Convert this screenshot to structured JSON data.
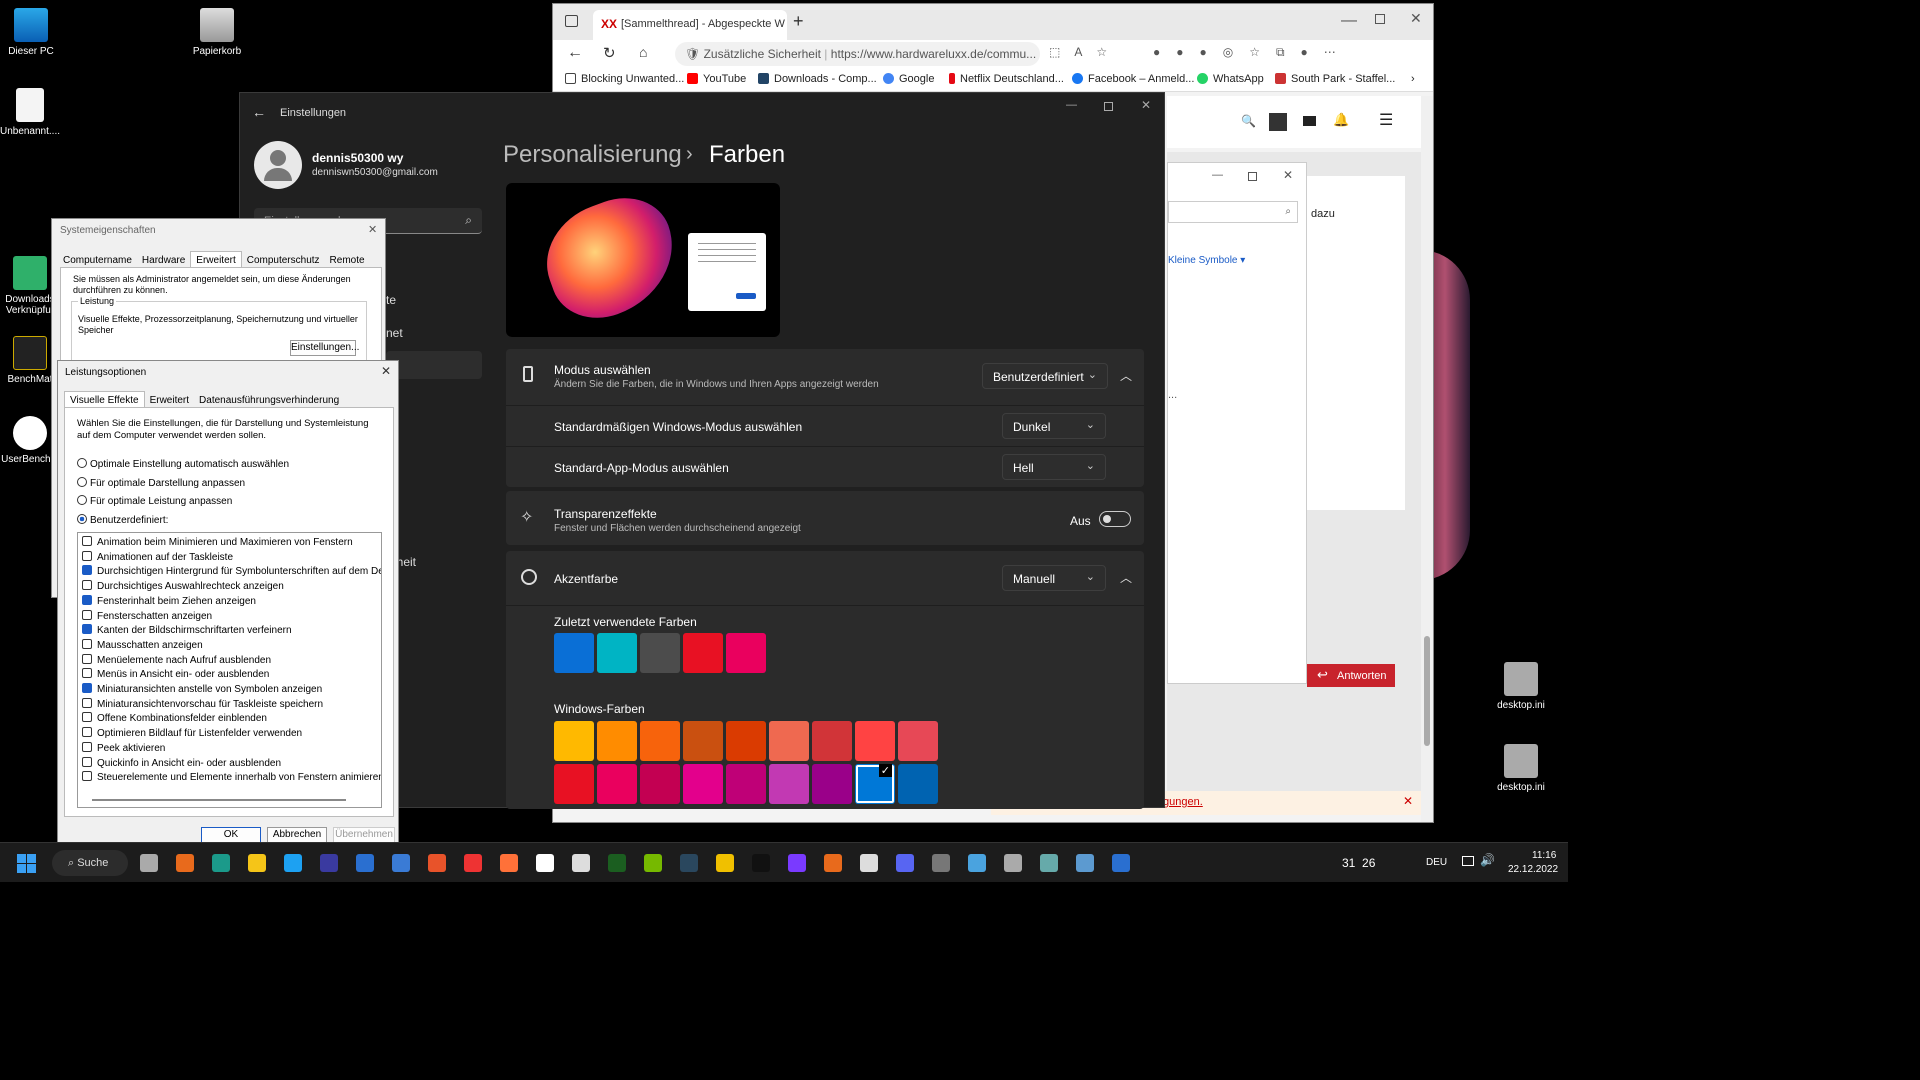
{
  "desktop": {
    "icons": [
      {
        "label": "Dieser PC"
      },
      {
        "label": "Papierkorb"
      },
      {
        "label": "Unbenannt...."
      },
      {
        "label": "Downloads Verknüpfur"
      },
      {
        "label": "BenchMat"
      },
      {
        "label": "UserBench..."
      },
      {
        "label": "desktop.ini"
      },
      {
        "label": "desktop.ini"
      }
    ]
  },
  "browser": {
    "tab_title": "[Sammelthread] - Abgespeckte W",
    "security_label": "Zusätzliche Sicherheit",
    "url": "https://www.hardwareluxx.de/commu...",
    "bookmarks": [
      "Blocking Unwanted...",
      "YouTube",
      "Downloads - Comp...",
      "Google",
      "Netflix Deutschland...",
      "Facebook – Anmeld...",
      "WhatsApp",
      "South Park - Staffel..."
    ],
    "page": {
      "dazu": "dazu",
      "view_label": "Kleine Symbole",
      "reply_button": "Antworten",
      "ellipsis": "...",
      "banner_link": "gungen."
    }
  },
  "settings": {
    "window_title": "Einstellungen",
    "user_name": "dennis50300 wy",
    "user_email": "denniswn50300@gmail.com",
    "search_placeholder": "Einstellung suchen",
    "nav_fragments": [
      "te",
      "net",
      "erheit"
    ],
    "breadcrumb_parent": "Personalisierung",
    "breadcrumb_sep": "›",
    "breadcrumb_current": "Farben",
    "mode": {
      "title": "Modus auswählen",
      "subtitle": "Ändern Sie die Farben, die in Windows und Ihren Apps angezeigt werden",
      "value": "Benutzerdefiniert"
    },
    "windows_mode": {
      "title": "Standardmäßigen Windows-Modus auswählen",
      "value": "Dunkel"
    },
    "app_mode": {
      "title": "Standard-App-Modus auswählen",
      "value": "Hell"
    },
    "transparency": {
      "title": "Transparenzeffekte",
      "subtitle": "Fenster und Flächen werden durchscheinend angezeigt",
      "state": "Aus"
    },
    "accent": {
      "title": "Akzentfarbe",
      "value": "Manuell"
    },
    "recent_colors_label": "Zuletzt verwendete Farben",
    "recent_colors": [
      "#0a6fd6",
      "#00b4c4",
      "#4c4c4c",
      "#e81123",
      "#ea005e"
    ],
    "windows_colors_label": "Windows-Farben",
    "windows_colors_row1": [
      "#ffb900",
      "#ff8c00",
      "#f7630c",
      "#ca5010",
      "#da3b01",
      "#ef6950",
      "#d13438",
      "#ff4343",
      "#e74856"
    ],
    "windows_colors_row2": [
      "#e81123",
      "#ea005e",
      "#c30052",
      "#e3008c",
      "#bf0077",
      "#c239b3",
      "#9a0089",
      "#0078d7",
      "#0063b1"
    ]
  },
  "sysprops": {
    "title": "Systemeigenschaften",
    "tabs": [
      "Computername",
      "Hardware",
      "Erweitert",
      "Computerschutz",
      "Remote"
    ],
    "admin_note": "Sie müssen als Administrator angemeldet sein, um diese Änderungen durchführen zu können.",
    "group_label": "Leistung",
    "group_text": "Visuelle Effekte, Prozessorzeitplanung, Speichernutzung und virtueller Speicher",
    "settings_button": "Einstellungen..."
  },
  "perf": {
    "title": "Leistungsoptionen",
    "tabs": [
      "Visuelle Effekte",
      "Erweitert",
      "Datenausführungsverhinderung"
    ],
    "intro": "Wählen Sie die Einstellungen, die für Darstellung und Systemleistung auf dem Computer verwendet werden sollen.",
    "radios": [
      {
        "label": "Optimale Einstellung automatisch auswählen",
        "on": false
      },
      {
        "label": "Für optimale Darstellung anpassen",
        "on": false
      },
      {
        "label": "Für optimale Leistung anpassen",
        "on": false
      },
      {
        "label": "Benutzerdefiniert:",
        "on": true
      }
    ],
    "options": [
      {
        "label": "Animation beim Minimieren und Maximieren von Fenstern",
        "on": false
      },
      {
        "label": "Animationen auf der Taskleiste",
        "on": false
      },
      {
        "label": "Durchsichtigen Hintergrund für Symbolunterschriften auf dem De",
        "on": true
      },
      {
        "label": "Durchsichtiges Auswahlrechteck anzeigen",
        "on": false
      },
      {
        "label": "Fensterinhalt beim Ziehen anzeigen",
        "on": true
      },
      {
        "label": "Fensterschatten anzeigen",
        "on": false
      },
      {
        "label": "Kanten der Bildschirmschriftarten verfeinern",
        "on": true
      },
      {
        "label": "Mausschatten anzeigen",
        "on": false
      },
      {
        "label": "Menüelemente nach Aufruf ausblenden",
        "on": false
      },
      {
        "label": "Menüs in Ansicht ein- oder ausblenden",
        "on": false
      },
      {
        "label": "Miniaturansichten anstelle von Symbolen anzeigen",
        "on": true
      },
      {
        "label": "Miniaturansichtenvorschau für Taskleiste speichern",
        "on": false
      },
      {
        "label": "Offene Kombinationsfelder einblenden",
        "on": false
      },
      {
        "label": "Optimieren Bildlauf für Listenfelder verwenden",
        "on": false
      },
      {
        "label": "Peek aktivieren",
        "on": false
      },
      {
        "label": "Quickinfo in Ansicht ein- oder ausblenden",
        "on": false
      },
      {
        "label": "Steuerelemente und Elemente innerhalb von Fenstern animieren",
        "on": false
      }
    ],
    "ok": "OK",
    "cancel": "Abbrechen",
    "apply": "Übernehmen"
  },
  "taskbar": {
    "search": "Suche",
    "temps": "31  26",
    "lang": "DEU",
    "time": "11:16",
    "date": "22.12.2022"
  }
}
